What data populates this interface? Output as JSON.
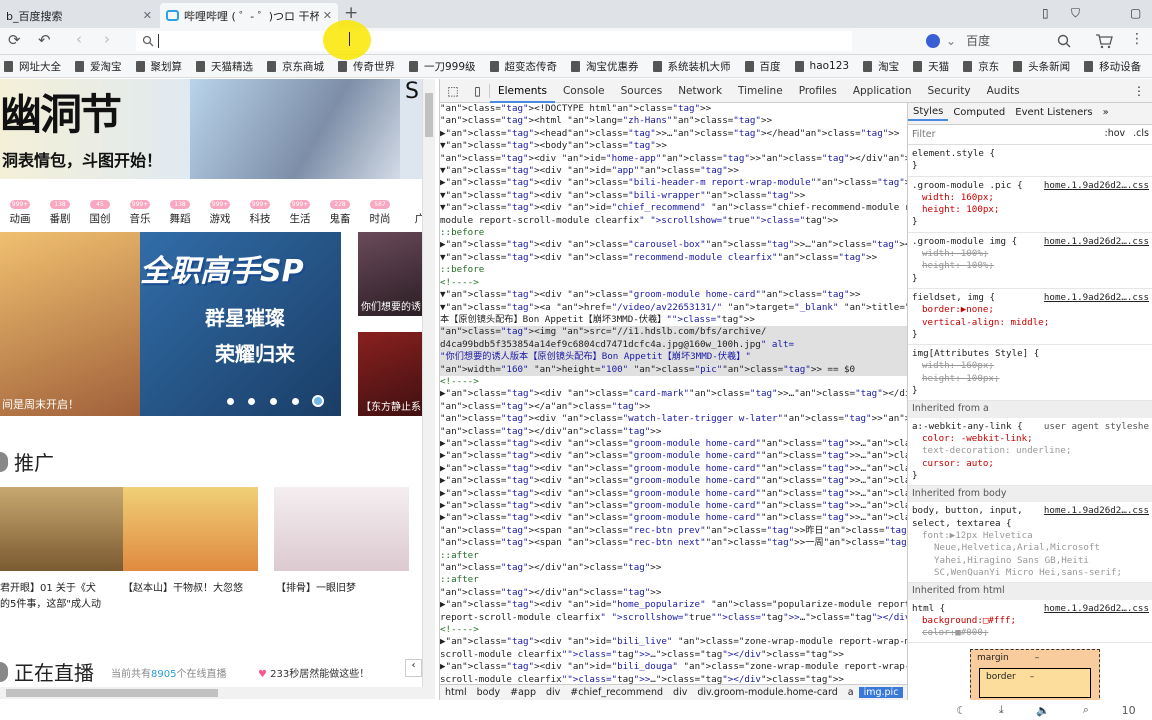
{
  "tabs": [
    {
      "label": "b_百度搜索",
      "close": "✕"
    },
    {
      "label": "哔哩哔哩 ( ゜- ゜)つロ 干杯~-b",
      "close": "✕"
    }
  ],
  "new_tab": "+",
  "window_icons": [
    "▯",
    "⛉",
    "▢"
  ],
  "toolbar": {
    "refresh": "⟳",
    "undo": "↶",
    "back": "‹",
    "forward": "›",
    "search_engine": "百度",
    "search_icon": "search-icon",
    "cart_icon": "cart-icon",
    "menu": "⋮"
  },
  "bookmarks": [
    "网址大全",
    "爱淘宝",
    "聚划算",
    "天猫精选",
    "京东商城",
    "传奇世界",
    "一刀999级",
    "超变态传奇",
    "淘宝优惠券",
    "系统装机大师",
    "百度",
    "hao123",
    "淘宝",
    "天猫",
    "京东",
    "头条新闻",
    "移动设备"
  ],
  "page": {
    "banner_title": "幽洞节",
    "banner_sub": "洞表情包，斗图开始！",
    "banner_right": "S",
    "categories": [
      {
        "label": "动画",
        "badge": "999+"
      },
      {
        "label": "番剧",
        "badge": "138"
      },
      {
        "label": "国创",
        "badge": "45"
      },
      {
        "label": "音乐",
        "badge": "999+"
      },
      {
        "label": "舞蹈",
        "badge": "138"
      },
      {
        "label": "游戏",
        "badge": "999+"
      },
      {
        "label": "科技",
        "badge": "999+"
      },
      {
        "label": "生活",
        "badge": "999+"
      },
      {
        "label": "鬼畜",
        "badge": "228"
      },
      {
        "label": "时尚",
        "badge": "587"
      },
      {
        "label": "广",
        "badge": ""
      }
    ],
    "carousel": {
      "title": "全职高手SP",
      "sub1": "群星璀璨",
      "sub2": "荣耀归来",
      "caption": "间是周末开启！"
    },
    "side_caption1": "你们想要的诱",
    "side_caption2": "【东方静止系",
    "promo_header": "推广",
    "cards": [
      {
        "caption1": "君开眼】01 关于《犬",
        "caption2": "的5件事，这部\"成人动"
      },
      {
        "caption1": "【赵本山】干物叔！大忽悠",
        "caption2": ""
      },
      {
        "caption1": "【排骨】一眼旧梦",
        "caption2": ""
      }
    ],
    "live_header": "正在直播",
    "live_stat_prefix": "当前共有",
    "live_stat_count": "8905",
    "live_stat_suffix": "个在线直播",
    "live_promo": "233秒居然能做这些！"
  },
  "devtools": {
    "tabs": [
      "Elements",
      "Console",
      "Sources",
      "Network",
      "Timeline",
      "Profiles",
      "Application",
      "Security",
      "Audits"
    ],
    "lines": [
      "<!DOCTYPE html>",
      "<html lang=\"zh-Hans\">",
      "▶<head>…</head>",
      "▼<body>",
      "    <div id=\"home-app\"></div>",
      "  ▼<div id=\"app\">",
      "    ▶<div class=\"bili-header-m report-wrap-module\">…</div>",
      "    ▼<div class=\"bili-wrapper\">",
      "      ▼<div id=\"chief_recommend\" class=\"chief-recommend-module report-wrap-",
      "       module report-scroll-module clearfix\" scrollshow=\"true\">",
      "          ::before",
      "        ▶<div class=\"carousel-box\">…</div>",
      "        ▼<div class=\"recommend-module clearfix\">",
      "            ::before",
      "            <!---->",
      "          ▼<div class=\"groom-module home-card\">",
      "            ▼<a href=\"/video/av22653131/\" target=\"_blank\" title=\"你们想要的诱人版",
      "             本【原创镜头配布】Bon Appetit【崩坏3MMD-伏羲】\">",
      "                <img src=\"//i1.hdslb.com/bfs/archive/",
      "                d4ca99bdb5f353854a14ef9c6804cd7471dcfc4a.jpg@160w_100h.jpg\" alt=",
      "                \"你们想要的诱人版本【原创镜头配布】Bon Appetit【崩坏3MMD-伏羲】\"",
      "                width=\"160\" height=\"100\" class=\"pic\"> == $0",
      "                <!---->",
      "              ▶<div class=\"card-mark\">…</div>",
      "              </a>",
      "              <div class=\"watch-later-trigger w-later\"></div>",
      "            </div>",
      "          ▶<div class=\"groom-module home-card\">…</div>",
      "          ▶<div class=\"groom-module home-card\">…</div>",
      "          ▶<div class=\"groom-module home-card\">…</div>",
      "          ▶<div class=\"groom-module home-card\">…</div>",
      "          ▶<div class=\"groom-module home-card\">…</div>",
      "          ▶<div class=\"groom-module home-card\">…</div>",
      "          ▶<div class=\"groom-module home-card\">…</div>",
      "            <span class=\"rec-btn prev\">昨日</span>",
      "            <span class=\"rec-btn next\">一周</span>",
      "            ::after",
      "          </div>",
      "          ::after",
      "        </div>",
      "      ▶<div id=\"home_popularize\" class=\"popularize-module report-wrap-module",
      "       report-scroll-module clearfix\" scrollshow=\"true\">…</div>",
      "        <!---->",
      "      ▶<div id=\"bili_live\" class=\"zone-wrap-module report-wrap-module report-",
      "       scroll-module clearfix\">…</div>",
      "      ▶<div id=\"bili_douga\" class=\"zone-wrap-module report-wrap-module report-",
      "       scroll-module clearfix\">…</div>"
    ],
    "breadcrumbs": [
      "html",
      "body",
      "#app",
      "div",
      "#chief_recommend",
      "div",
      "div.groom-module.home-card",
      "a",
      "img.pic"
    ],
    "styles_tabs": [
      "Styles",
      "Computed",
      "Event Listeners",
      "»"
    ],
    "filter_placeholder": "Filter",
    "hov": ":hov",
    "cls": ".cls",
    "rules": [
      {
        "selector": "element.style {",
        "src": "",
        "props": []
      },
      {
        "selector": ".groom-module .pic {",
        "src": "home.1.9ad26d2….css",
        "props": [
          {
            "t": "width: 160px;",
            "s": false
          },
          {
            "t": "height: 100px;",
            "s": false
          }
        ]
      },
      {
        "selector": ".groom-module img {",
        "src": "home.1.9ad26d2….css",
        "props": [
          {
            "t": "width: 100%;",
            "s": true
          },
          {
            "t": "height: 100%;",
            "s": true
          }
        ]
      },
      {
        "selector": "fieldset, img {",
        "src": "home.1.9ad26d2….css",
        "props": [
          {
            "t": "border:▶none;",
            "s": false
          },
          {
            "t": "vertical-align: middle;",
            "s": false
          }
        ]
      },
      {
        "selector": "img[Attributes Style] {",
        "src": "",
        "props": [
          {
            "t": "width: 160px;",
            "s": true
          },
          {
            "t": "height: 100px;",
            "s": true
          }
        ]
      }
    ],
    "inherited_a": "Inherited from a",
    "rule_a": {
      "selector": "a:-webkit-any-link {",
      "src": "user agent styleshe",
      "props": [
        "color: -webkit-link;",
        "text-decoration: underline;",
        "cursor: auto;"
      ]
    },
    "inherited_body": "Inherited from body",
    "rule_body": {
      "selector": "body, button, input,",
      "selector2": "select, textarea {",
      "src": "home.1.9ad26d2….css",
      "props": [
        "font:▶12px Helvetica",
        "Neue,Helvetica,Arial,Microsoft",
        "Yahei,Hiragino Sans GB,Heiti",
        "SC,WenQuanYi Micro Hei,sans-serif;"
      ]
    },
    "inherited_html": "Inherited from html",
    "rule_html": {
      "selector": "html {",
      "src": "home.1.9ad26d2….css",
      "props": [
        {
          "t": "background:□#fff;",
          "s": false
        },
        {
          "t": "color:■#000;",
          "s": true
        }
      ]
    },
    "boxmodel": {
      "margin": "margin",
      "dash": "–",
      "border": "border"
    }
  },
  "status_icons": [
    "moon-icon",
    "download-icon",
    "volume-icon",
    "zoom-icon"
  ],
  "zoom": "10"
}
